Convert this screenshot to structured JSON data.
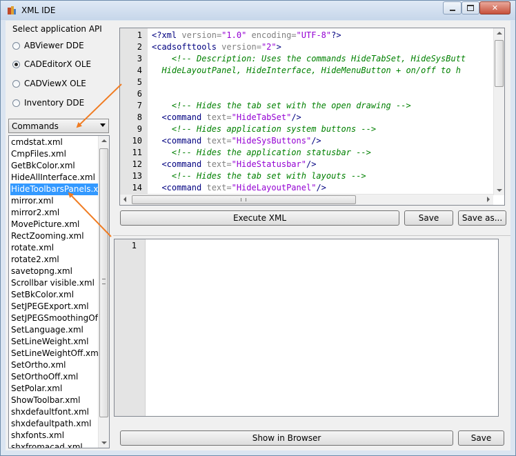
{
  "window": {
    "title": "XML IDE"
  },
  "api": {
    "label": "Select application API",
    "options": [
      {
        "label": "ABViewer DDE",
        "selected": false
      },
      {
        "label": "CADEditorX OLE",
        "selected": true
      },
      {
        "label": "CADViewX OLE",
        "selected": false
      },
      {
        "label": "Inventory DDE",
        "selected": false
      }
    ]
  },
  "combo": {
    "value": "Commands"
  },
  "files": [
    "cmdstat.xml",
    "CmpFiles.xml",
    "GetBkColor.xml",
    "HideAllInterface.xml",
    "HideToolbarsPanels.xml",
    "mirror.xml",
    "mirror2.xml",
    "MovePicture.xml",
    "RectZooming.xml",
    "rotate.xml",
    "rotate2.xml",
    "savetopng.xml",
    "Scrollbar visible.xml",
    "SetBkColor.xml",
    "SetJPEGExport.xml",
    "SetJPEGSmoothingOff",
    "SetLanguage.xml",
    "SetLineWeight.xml",
    "SetLineWeightOff.xml",
    "SetOrtho.xml",
    "SetOrthoOff.xml",
    "SetPolar.xml",
    "ShowToolbar.xml",
    "shxdefaultfont.xml",
    "shxdefaultpath.xml",
    "shxfonts.xml",
    "shxfromacad.xml"
  ],
  "files_display": [
    "cmdstat.xml",
    "CmpFiles.xml",
    "GetBkColor.xml",
    "HideAllInterface.xml",
    "HideToolbarsPanels.x",
    "mirror.xml",
    "mirror2.xml",
    "MovePicture.xml",
    "RectZooming.xml",
    "rotate.xml",
    "rotate2.xml",
    "savetopng.xml",
    "Scrollbar visible.xml",
    "SetBkColor.xml",
    "SetJPEGExport.xml",
    "SetJPEGSmoothingOff",
    "SetLanguage.xml",
    "SetLineWeight.xml",
    "SetLineWeightOff.xml",
    "SetOrtho.xml",
    "SetOrthoOff.xml",
    "SetPolar.xml",
    "ShowToolbar.xml",
    "shxdefaultfont.xml",
    "shxdefaultpath.xml",
    "shxfonts.xml",
    "shxfromacad.xml"
  ],
  "selected_file_index": 4,
  "editor": {
    "line_numbers": [
      "1",
      "2",
      "3",
      "4",
      "5",
      "6",
      "7",
      "8",
      "9",
      "10",
      "11",
      "12",
      "13",
      "14"
    ],
    "lines": [
      [
        {
          "t": "<?",
          "c": "tag"
        },
        {
          "t": "xml",
          "c": "tag"
        },
        {
          "t": " version=",
          "c": "attr"
        },
        {
          "t": "\"1.0\"",
          "c": "str"
        },
        {
          "t": " encoding=",
          "c": "attr"
        },
        {
          "t": "\"UTF-8\"",
          "c": "str"
        },
        {
          "t": "?>",
          "c": "tag"
        }
      ],
      [
        {
          "t": "<cadsofttools",
          "c": "tag"
        },
        {
          "t": " version=",
          "c": "attr"
        },
        {
          "t": "\"2\"",
          "c": "str"
        },
        {
          "t": ">",
          "c": "tag"
        }
      ],
      [
        {
          "t": "    <!-- Description: Uses the commands HideTabSet, HideSysButt",
          "c": "cmt"
        }
      ],
      [
        {
          "t": "  HideLayoutPanel, HideInterface, HideMenuButton + on/off to h",
          "c": "cmt"
        }
      ],
      [],
      [],
      [
        {
          "t": "    <!-- Hides the tab set with the open drawing -->",
          "c": "cmt"
        }
      ],
      [
        {
          "t": "  <command",
          "c": "tag"
        },
        {
          "t": " text=",
          "c": "attr"
        },
        {
          "t": "\"HideTabSet\"",
          "c": "str"
        },
        {
          "t": "/>",
          "c": "tag"
        }
      ],
      [
        {
          "t": "    <!-- Hides application system buttons -->",
          "c": "cmt"
        }
      ],
      [
        {
          "t": "  <command",
          "c": "tag"
        },
        {
          "t": " text=",
          "c": "attr"
        },
        {
          "t": "\"HideSysButtons\"",
          "c": "str"
        },
        {
          "t": "/>",
          "c": "tag"
        }
      ],
      [
        {
          "t": "    <!-- Hides the application statusbar -->",
          "c": "cmt"
        }
      ],
      [
        {
          "t": "  <command",
          "c": "tag"
        },
        {
          "t": " text=",
          "c": "attr"
        },
        {
          "t": "\"HideStatusbar\"",
          "c": "str"
        },
        {
          "t": "/>",
          "c": "tag"
        }
      ],
      [
        {
          "t": "    <!-- Hides the tab set with layouts -->",
          "c": "cmt"
        }
      ],
      [
        {
          "t": "  <command",
          "c": "tag"
        },
        {
          "t": " text=",
          "c": "attr"
        },
        {
          "t": "\"HideLayoutPanel\"",
          "c": "str"
        },
        {
          "t": "/>",
          "c": "tag"
        }
      ]
    ]
  },
  "buttons": {
    "execute": "Execute XML",
    "save_top": "Save",
    "save_as": "Save as...",
    "show_browser": "Show in Browser",
    "save_bottom": "Save"
  },
  "output": {
    "line_numbers": [
      "1"
    ]
  },
  "colors": {
    "arrow": "#f07c22",
    "selection": "#3399ff"
  }
}
